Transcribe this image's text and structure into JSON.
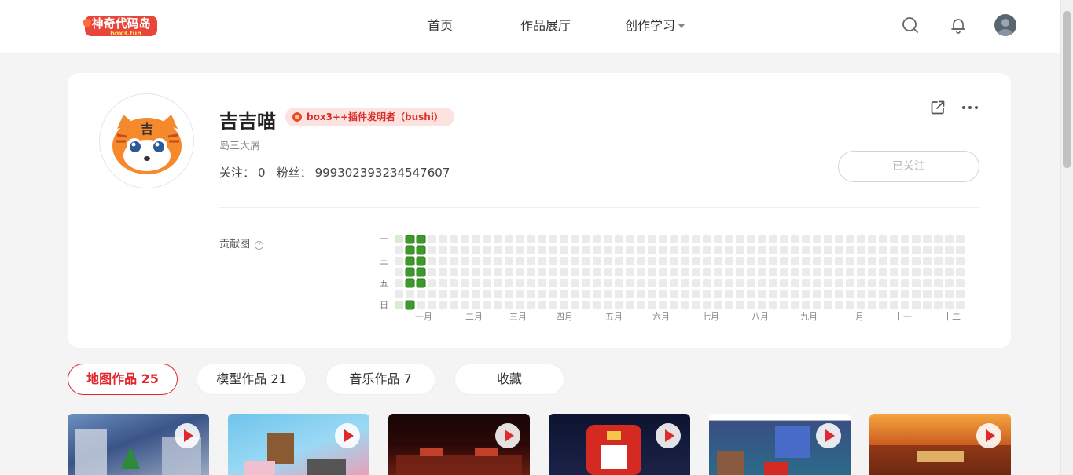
{
  "header": {
    "logo_text": "神奇代码岛",
    "logo_subtext": "box3.fun",
    "nav": [
      {
        "label": "首页"
      },
      {
        "label": "作品展厅"
      },
      {
        "label": "创作学习"
      }
    ]
  },
  "profile": {
    "name": "吉吉喵",
    "badge": "box3++插件发明者（bushi）",
    "bio": "岛三大屑",
    "following_label": "关注：",
    "following_count": "0",
    "fans_label": "粉丝：",
    "fans_count": "999302393234547607",
    "follow_button": "已关注",
    "avatar_char": "吉"
  },
  "contribution": {
    "label": "贡献图",
    "help_icon": "?",
    "weekday_labels": [
      "一",
      "",
      "三",
      "",
      "五",
      "",
      "日"
    ],
    "month_labels": [
      "一月",
      "二月",
      "三月",
      "四月",
      "五月",
      "六月",
      "七月",
      "八月",
      "九月",
      "十月",
      "十一",
      "十二"
    ],
    "active_cells": [
      {
        "week": 1,
        "day": 0
      },
      {
        "week": 1,
        "day": 1
      },
      {
        "week": 1,
        "day": 2
      },
      {
        "week": 1,
        "day": 3
      },
      {
        "week": 1,
        "day": 4
      },
      {
        "week": 1,
        "day": 6
      },
      {
        "week": 2,
        "day": 0
      },
      {
        "week": 2,
        "day": 1
      },
      {
        "week": 2,
        "day": 2
      },
      {
        "week": 2,
        "day": 3
      },
      {
        "week": 2,
        "day": 4
      }
    ],
    "colors": {
      "empty": "#ebebeb",
      "faint": "#d9ecd1",
      "filled": "#3c9a2a",
      "border": "#2d7b1c"
    }
  },
  "tabs": [
    {
      "label": "地图作品 25"
    },
    {
      "label": "模型作品 21"
    },
    {
      "label": "音乐作品 7"
    },
    {
      "label": "收藏"
    }
  ],
  "colors": {
    "accent": "#e0282e",
    "badge_bg": "#fde3e0"
  },
  "icons": {
    "search": "search-icon",
    "bell": "bell-icon",
    "share": "share-icon",
    "more": "more-icon",
    "play": "play-icon"
  }
}
